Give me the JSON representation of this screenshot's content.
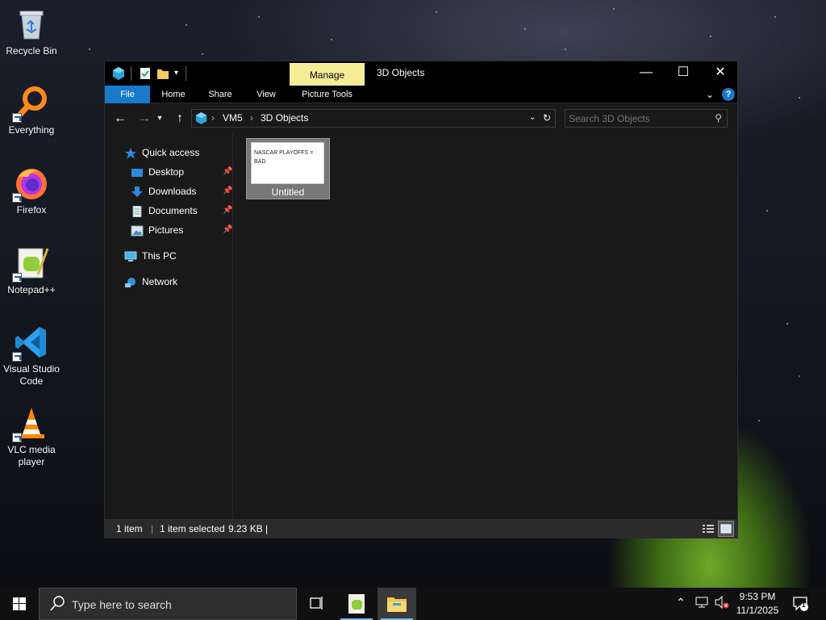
{
  "desktop": {
    "icons": [
      {
        "label": "Recycle Bin",
        "icon": "recycle-bin-icon"
      },
      {
        "label": "Everything",
        "icon": "everything-search-icon"
      },
      {
        "label": "Firefox",
        "icon": "firefox-icon"
      },
      {
        "label": "Notepad++",
        "icon": "notepad-plus-plus-icon"
      },
      {
        "label": "Visual Studio Code",
        "icon": "vscode-icon"
      },
      {
        "label": "VLC media player",
        "icon": "vlc-icon"
      }
    ]
  },
  "explorer": {
    "title": "3D Objects",
    "context_tab": "Manage",
    "ribbon_tabs": [
      "File",
      "Home",
      "Share",
      "View",
      "Picture Tools"
    ],
    "address": {
      "crumbs": [
        "VM5",
        "3D Objects"
      ]
    },
    "search_placeholder": "Search 3D Objects",
    "nav": {
      "quick_access": "Quick access",
      "pinned": [
        "Desktop",
        "Downloads",
        "Documents",
        "Pictures"
      ],
      "this_pc": "This PC",
      "network": "Network"
    },
    "files": [
      {
        "name": "Untitled",
        "thumbnail_text": "NASCAR PLAYOFFS = BAD",
        "selected": true
      }
    ],
    "status": {
      "count": "1 item",
      "selection": "1 item selected",
      "size": "9.23 KB",
      "separator": "|"
    },
    "colors": {
      "accent": "#1979ca",
      "manage_tab": "#f6ee97",
      "background": "#191919"
    }
  },
  "taskbar": {
    "search_placeholder": "Type here to search",
    "clock_time": "9:53 PM",
    "clock_date": "11/1/2025",
    "notification_count": "1"
  }
}
